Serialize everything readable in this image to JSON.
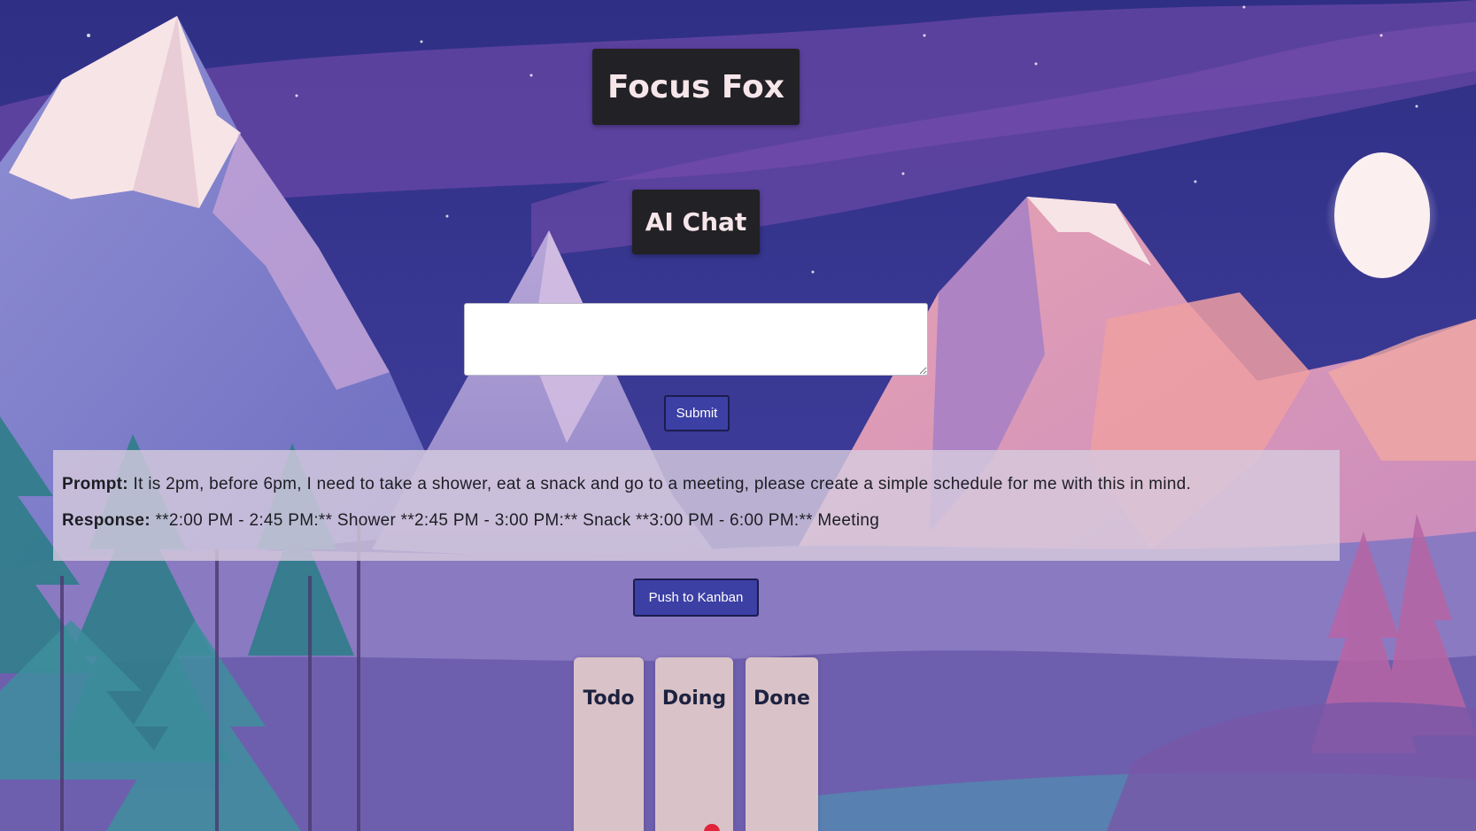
{
  "app": {
    "title": "Focus Fox",
    "section_title": "AI Chat"
  },
  "chat": {
    "input_value": "",
    "submit_label": "Submit"
  },
  "result": {
    "prompt_label": "Prompt:",
    "prompt_text": "It is 2pm, before 6pm, I need to take a shower, eat a snack and go to a meeting, please create a simple schedule for me with this in mind.",
    "response_label": "Response:",
    "response_text": "**2:00 PM - 2:45 PM:** Shower **2:45 PM - 3:00 PM:** Snack **3:00 PM - 6:00 PM:** Meeting"
  },
  "kanban": {
    "push_label": "Push to Kanban",
    "columns": [
      {
        "title": "Todo"
      },
      {
        "title": "Doing"
      },
      {
        "title": "Done"
      }
    ]
  },
  "colors": {
    "sky": "#3b3a93",
    "header_box": "#222125",
    "button": "#3c3fa3",
    "panel": "#d6cade",
    "kanban_column": "#d9c3c8",
    "moon": "#fbeff0"
  }
}
